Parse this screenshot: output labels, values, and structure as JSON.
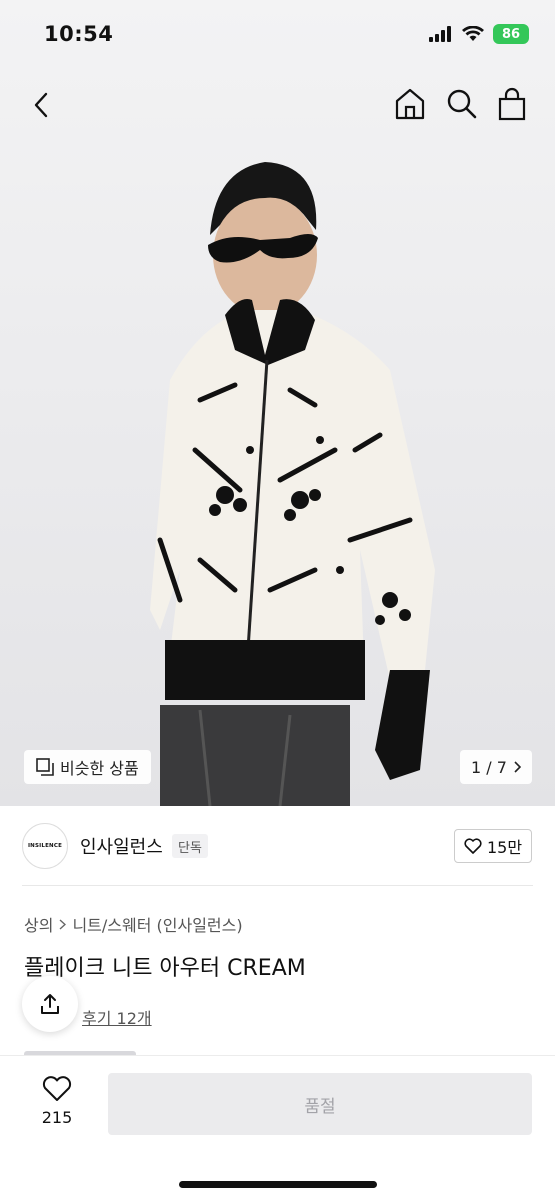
{
  "status_bar": {
    "time": "10:54",
    "battery": "86"
  },
  "nav": {
    "icons": [
      "back-icon",
      "home-icon",
      "search-icon",
      "shopping-bag-icon"
    ]
  },
  "gallery": {
    "similar_label": "비슷한 상품",
    "counter": "1 / 7"
  },
  "brand": {
    "logo_text": "INSILENCE",
    "name": "인사일런스",
    "badge": "단독",
    "likes": "15만"
  },
  "breadcrumb": {
    "category": "상의",
    "subcategory": "니트/스웨터 (인사일런스)"
  },
  "product": {
    "title": "플레이크 니트 아우터 CREAM",
    "review_link": "후기 12개"
  },
  "bottom_bar": {
    "wish_count": "215",
    "buy_button": "품절"
  },
  "colors": {
    "battery": "#34c759",
    "soldout_bg": "#ebebed",
    "soldout_text": "#a3a3a8"
  }
}
